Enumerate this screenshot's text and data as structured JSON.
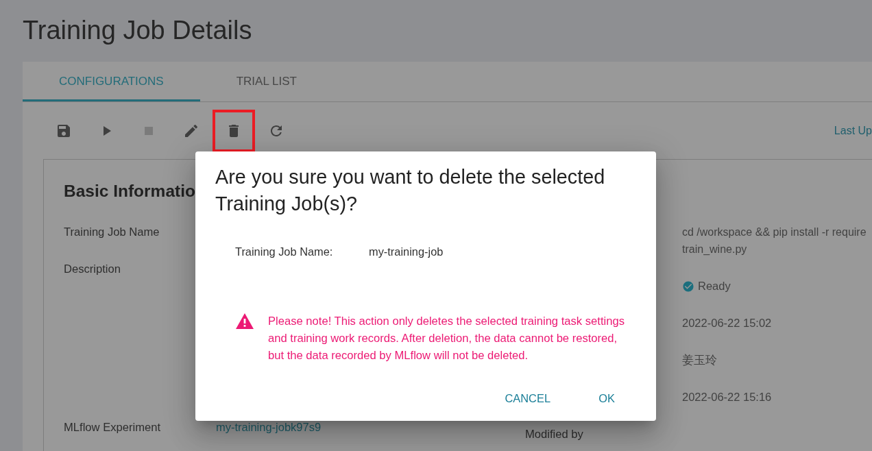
{
  "page": {
    "title": "Training Job Details"
  },
  "tabs": [
    {
      "label": "CONFIGURATIONS",
      "selected": true
    },
    {
      "label": "TRIAL LIST",
      "selected": false
    }
  ],
  "toolbar": {
    "buttons": [
      {
        "kind": "save",
        "disabled": false,
        "highlighted": false
      },
      {
        "kind": "run",
        "disabled": false,
        "highlighted": false
      },
      {
        "kind": "stop",
        "disabled": true,
        "highlighted": false
      },
      {
        "kind": "edit",
        "disabled": false,
        "highlighted": false
      },
      {
        "kind": "delete",
        "disabled": false,
        "highlighted": true
      },
      {
        "kind": "refresh",
        "disabled": false,
        "highlighted": false
      }
    ],
    "last_updated": "Last Up"
  },
  "basic_information": {
    "title": "Basic Informatio",
    "left_fields": [
      {
        "kind": "text",
        "label": "Training Job Name"
      },
      {
        "kind": "textarea",
        "label": "Description"
      },
      {
        "kind": "link",
        "label": "MLflow Experiment",
        "value": "my-training-jobk97s9"
      }
    ],
    "right_fields": [
      {
        "kind": "lines",
        "lines": [
          "cd /workspace && pip install -r require",
          "train_wine.py"
        ]
      },
      {
        "kind": "status",
        "value": "Ready"
      },
      {
        "kind": "text",
        "value": "2022-06-22 15:02"
      },
      {
        "kind": "text",
        "value": "姜玉玲"
      },
      {
        "kind": "text",
        "value": "2022-06-22 15:16"
      },
      {
        "kind": "text",
        "label": "Modified by"
      }
    ]
  },
  "dialog": {
    "title": "Are you sure you want to delete the selected Training Job(s)?",
    "field": {
      "label": "Training Job Name:",
      "value": "my-training-job"
    },
    "warning_lines": [
      "Please note! This action only deletes the selected training task settings",
      "and training work records. After deletion, the data cannot be restored,",
      "but the data recorded by MLflow will not be deleted."
    ],
    "buttons": [
      {
        "label": "CANCEL"
      },
      {
        "label": "OK"
      }
    ]
  }
}
